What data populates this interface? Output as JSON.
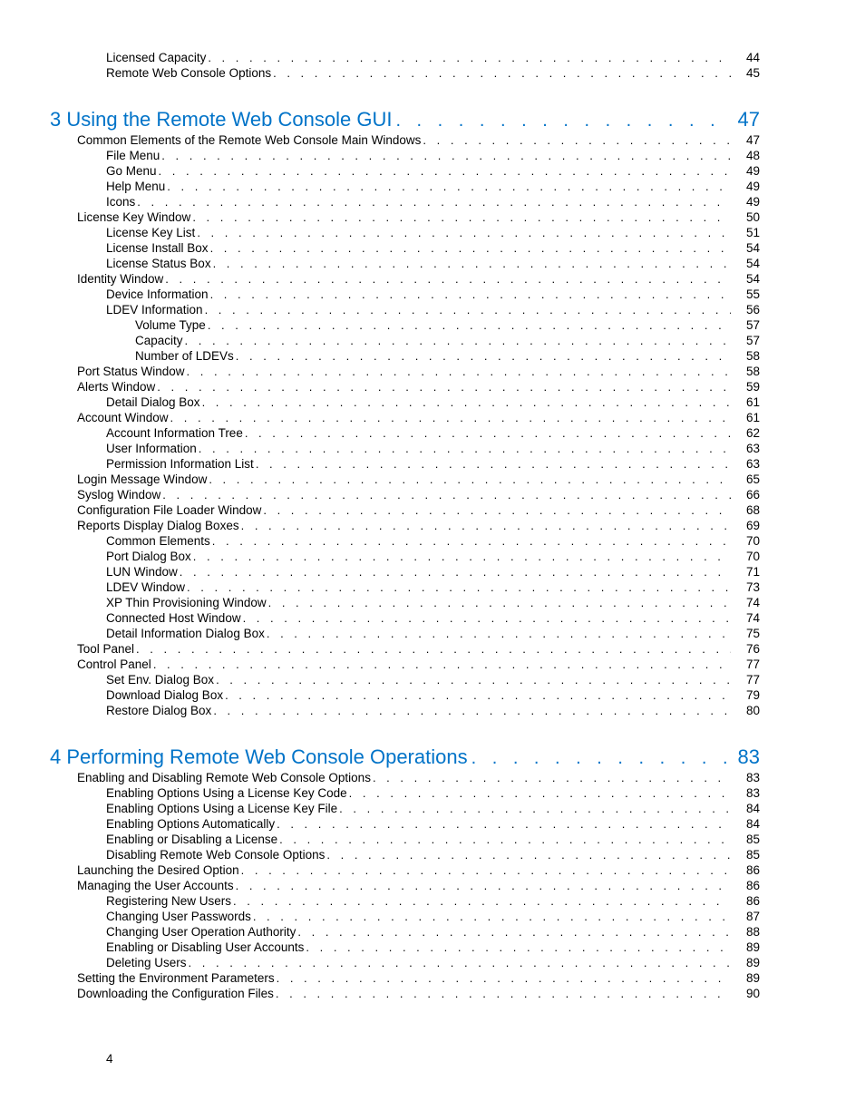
{
  "page_number": "4",
  "pre_entries": [
    {
      "label": "Licensed Capacity",
      "page": "44",
      "indent": 2
    },
    {
      "label": "Remote Web Console Options",
      "page": "45",
      "indent": 2
    }
  ],
  "sections": [
    {
      "title": "3 Using the Remote Web Console GUI",
      "page": "47",
      "entries": [
        {
          "label": "Common Elements of the Remote Web Console Main Windows",
          "page": "47",
          "indent": 1
        },
        {
          "label": "File Menu",
          "page": "48",
          "indent": 2
        },
        {
          "label": "Go Menu",
          "page": "49",
          "indent": 2
        },
        {
          "label": "Help Menu",
          "page": "49",
          "indent": 2
        },
        {
          "label": "Icons",
          "page": "49",
          "indent": 2
        },
        {
          "label": "License Key Window",
          "page": "50",
          "indent": 1
        },
        {
          "label": "License Key List",
          "page": "51",
          "indent": 2
        },
        {
          "label": "License Install Box",
          "page": "54",
          "indent": 2
        },
        {
          "label": "License Status Box",
          "page": "54",
          "indent": 2
        },
        {
          "label": "Identity Window",
          "page": "54",
          "indent": 1
        },
        {
          "label": "Device Information",
          "page": "55",
          "indent": 2
        },
        {
          "label": "LDEV Information",
          "page": "56",
          "indent": 2
        },
        {
          "label": "Volume Type",
          "page": "57",
          "indent": 3
        },
        {
          "label": "Capacity",
          "page": "57",
          "indent": 3
        },
        {
          "label": "Number of LDEVs",
          "page": "58",
          "indent": 3
        },
        {
          "label": "Port Status Window",
          "page": "58",
          "indent": 1
        },
        {
          "label": "Alerts Window",
          "page": "59",
          "indent": 1
        },
        {
          "label": "Detail Dialog Box",
          "page": "61",
          "indent": 2
        },
        {
          "label": "Account Window",
          "page": "61",
          "indent": 1
        },
        {
          "label": "Account Information Tree",
          "page": "62",
          "indent": 2
        },
        {
          "label": "User Information",
          "page": "63",
          "indent": 2
        },
        {
          "label": "Permission Information List",
          "page": "63",
          "indent": 2
        },
        {
          "label": "Login Message Window",
          "page": "65",
          "indent": 1
        },
        {
          "label": "Syslog Window",
          "page": "66",
          "indent": 1
        },
        {
          "label": "Configuration File Loader Window",
          "page": "68",
          "indent": 1
        },
        {
          "label": "Reports Display Dialog Boxes",
          "page": "69",
          "indent": 1
        },
        {
          "label": "Common Elements",
          "page": "70",
          "indent": 2
        },
        {
          "label": "Port Dialog Box",
          "page": "70",
          "indent": 2
        },
        {
          "label": "LUN Window",
          "page": "71",
          "indent": 2
        },
        {
          "label": "LDEV Window",
          "page": "73",
          "indent": 2
        },
        {
          "label": "XP Thin Provisioning Window",
          "page": "74",
          "indent": 2
        },
        {
          "label": "Connected Host Window",
          "page": "74",
          "indent": 2
        },
        {
          "label": "Detail Information Dialog Box",
          "page": "75",
          "indent": 2
        },
        {
          "label": "Tool Panel",
          "page": "76",
          "indent": 1
        },
        {
          "label": "Control Panel",
          "page": "77",
          "indent": 1
        },
        {
          "label": "Set Env. Dialog Box",
          "page": "77",
          "indent": 2
        },
        {
          "label": "Download Dialog Box",
          "page": "79",
          "indent": 2
        },
        {
          "label": "Restore Dialog Box",
          "page": "80",
          "indent": 2
        }
      ]
    },
    {
      "title": "4 Performing Remote Web Console Operations",
      "page": "83",
      "entries": [
        {
          "label": "Enabling and Disabling Remote Web Console Options",
          "page": "83",
          "indent": 1
        },
        {
          "label": "Enabling Options Using a License Key Code",
          "page": "83",
          "indent": 2
        },
        {
          "label": "Enabling Options Using a License Key File",
          "page": "84",
          "indent": 2
        },
        {
          "label": "Enabling Options Automatically",
          "page": "84",
          "indent": 2
        },
        {
          "label": "Enabling or Disabling a License",
          "page": "85",
          "indent": 2
        },
        {
          "label": "Disabling Remote Web Console Options",
          "page": "85",
          "indent": 2
        },
        {
          "label": "Launching the Desired Option",
          "page": "86",
          "indent": 1
        },
        {
          "label": "Managing the User Accounts",
          "page": "86",
          "indent": 1
        },
        {
          "label": "Registering New Users",
          "page": "86",
          "indent": 2
        },
        {
          "label": "Changing User Passwords",
          "page": "87",
          "indent": 2
        },
        {
          "label": "Changing User Operation Authority",
          "page": "88",
          "indent": 2
        },
        {
          "label": "Enabling or Disabling User Accounts",
          "page": "89",
          "indent": 2
        },
        {
          "label": "Deleting Users",
          "page": "89",
          "indent": 2
        },
        {
          "label": "Setting the Environment Parameters",
          "page": "89",
          "indent": 1
        },
        {
          "label": "Downloading the Configuration Files",
          "page": "90",
          "indent": 1
        }
      ]
    }
  ]
}
